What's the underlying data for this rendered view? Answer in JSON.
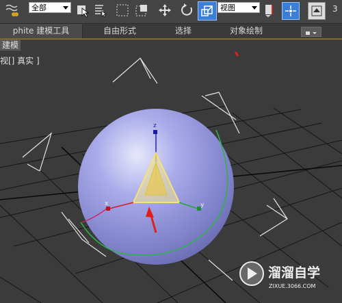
{
  "toolbar": {
    "selection_filter": "全部",
    "ref_coord": "视图",
    "counter": "3"
  },
  "ribbon": {
    "tabs": [
      {
        "label": "phite 建模工具",
        "active": true
      },
      {
        "label": "自由形式",
        "active": false
      },
      {
        "label": "选择",
        "active": false
      },
      {
        "label": "对象绘制",
        "active": false
      }
    ],
    "subtab": "建模"
  },
  "viewport": {
    "label": "视[] 真实 ]",
    "gizmo": {
      "z": "z",
      "x": "x",
      "y": "y"
    }
  },
  "watermark": {
    "title": "溜溜自学",
    "url": "ZIXUE.3066.COM"
  },
  "colors": {
    "sphere": "#9b9de3",
    "highlight_button": "#3a7ed8",
    "arrow": "#e0211b"
  }
}
